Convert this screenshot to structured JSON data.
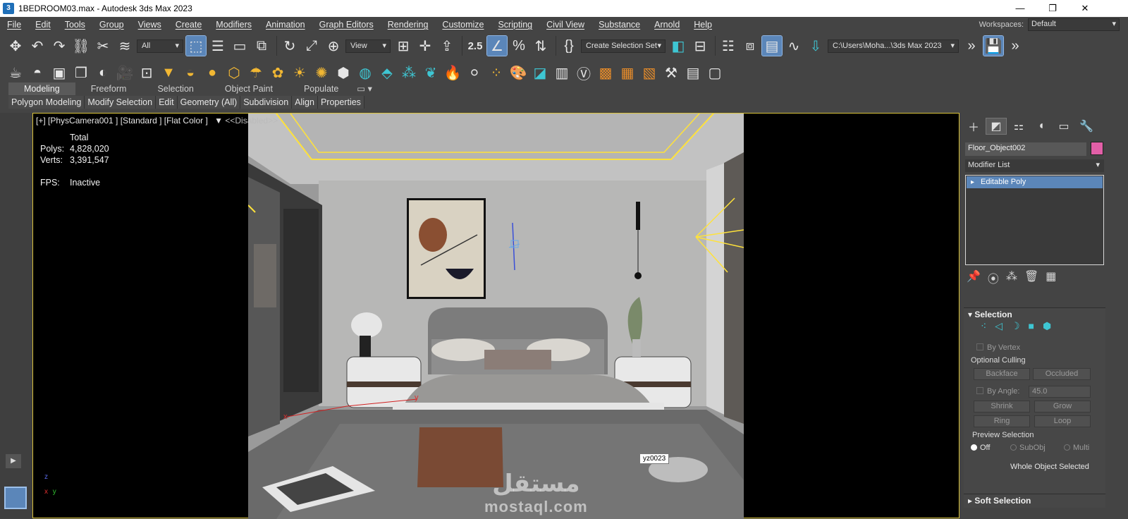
{
  "window": {
    "title": "1BEDROOM03.max - Autodesk 3ds Max 2023",
    "app_icon": "3",
    "minimize": "—",
    "maximize": "❐",
    "close": "✕"
  },
  "menu": [
    "File",
    "Edit",
    "Tools",
    "Group",
    "Views",
    "Create",
    "Modifiers",
    "Animation",
    "Graph Editors",
    "Rendering",
    "Customize",
    "Scripting",
    "Civil View",
    "Substance",
    "Arnold",
    "Help"
  ],
  "workspace": {
    "label": "Workspaces:",
    "value": "Default"
  },
  "toolbar1": {
    "filter": "All",
    "ref_coord": "View",
    "selection_set": "Create Selection Set",
    "path": "C:\\Users\\Moha...\\3ds Max 2023",
    "snap_label": "2.5",
    "icons": [
      "move-icon",
      "undo-icon",
      "redo-icon",
      "link-icon",
      "unlink-icon",
      "bind-spacewarp-icon"
    ]
  },
  "ribbon": {
    "tabs": [
      "Modeling",
      "Freeform",
      "Selection",
      "Object Paint",
      "Populate"
    ],
    "active_tab": "Modeling",
    "items": [
      "Polygon Modeling",
      "Modify Selection",
      "Edit",
      "Geometry (All)",
      "Subdivision",
      "Align",
      "Properties"
    ]
  },
  "viewport": {
    "label": "[+] [PhysCamera001 ] [Standard ] [Flat Color ]",
    "filter_text": "<<Disabled>>",
    "stats_header": "Total",
    "polys_label": "Polys:",
    "polys_value": "4,828,020",
    "verts_label": "Verts:",
    "verts_value": "3,391,547",
    "fps_label": "FPS:",
    "fps_value": "Inactive",
    "tag": "yz0023",
    "axis_y": "y",
    "axis_x": "x",
    "gizmo_z": "z",
    "gizmo_y": "y",
    "gizmo_x": "x",
    "watermark": "mostaql.com",
    "watermark_ar": "مستقل"
  },
  "command_panel": {
    "object_name": "Floor_Object002",
    "object_color": "#e25fa7",
    "modifier_list": "Modifier List",
    "stack_item": "Editable Poly",
    "selection_title": "Selection",
    "by_vertex": "By Vertex",
    "optional_culling": "Optional Culling",
    "backface": "Backface",
    "occluded": "Occluded",
    "by_angle": "By Angle:",
    "angle_value": "45.0",
    "shrink": "Shrink",
    "grow": "Grow",
    "ring": "Ring",
    "loop": "Loop",
    "preview_selection": "Preview Selection",
    "off": "Off",
    "subobj": "SubObj",
    "multi": "Multi",
    "whole_object": "Whole Object Selected",
    "soft_selection": "Soft Selection"
  }
}
